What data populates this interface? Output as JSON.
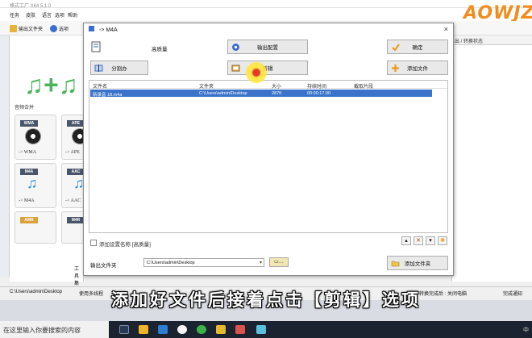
{
  "bg": {
    "title": "格式工厂 X64 5.1.0",
    "menu": [
      "任务",
      "皮肤",
      "语言",
      "帮助"
    ],
    "menu_right": [
      "选项",
      "帮助"
    ],
    "toolbar": {
      "output_folder": "输出文件夹",
      "options": "选项"
    },
    "left_panel": {
      "merge_label": "音频合并",
      "tiles": [
        {
          "fmt": "WMA",
          "label": "-> WMA"
        },
        {
          "fmt": "APE",
          "label": "-> APE"
        },
        {
          "fmt": "M4A",
          "label": "-> M4A"
        },
        {
          "fmt": "AAC",
          "label": "-> AAC"
        },
        {
          "fmt": "AMR",
          "label": ""
        },
        {
          "fmt": "M4R",
          "label": ""
        }
      ],
      "toolbox": "工具集"
    },
    "right_header": "出 / 转换状态",
    "status": {
      "path": "C:\\Users\\admin\\Desktop",
      "multithread": "使用多线程",
      "time": "耗时 : 00:00:00",
      "after": "转换完成后 : 关闭电脑",
      "notify": "完成通知"
    },
    "logo": "AOWJZ"
  },
  "dialog": {
    "title": "-> M4A",
    "close": "×",
    "quality_label": "高质量",
    "output_config": "输出配置",
    "ok": "确定",
    "split": "分割办",
    "clip": "剪辑",
    "add_file": "添加文件",
    "columns": [
      "文件名",
      "文件夹",
      "大小",
      "持续时间",
      "截取片段"
    ],
    "rows": [
      {
        "name": "新录音 18.m4a",
        "folder": "C:\\Users\\admin\\Desktop",
        "size": "287K",
        "duration": "00:00:17.00",
        "clip": ""
      }
    ],
    "add_setting_name": "添加设置名称 [高质量]",
    "output_folder_label": "输出文件夹",
    "output_folder_value": "C:\\Users\\admin\\Desktop",
    "add_folder": "添加文件夹"
  },
  "subtitle": "添加好文件后接着点击【剪辑】选项",
  "taskbar": {
    "search": "在这里输入你要搜索的内容",
    "tray": "中"
  },
  "colors": {
    "selection": "#3a73c9",
    "subtitle_text": "#ffffff",
    "taskbar": "#1c2330",
    "cursor_highlight": "#ffe54a"
  }
}
